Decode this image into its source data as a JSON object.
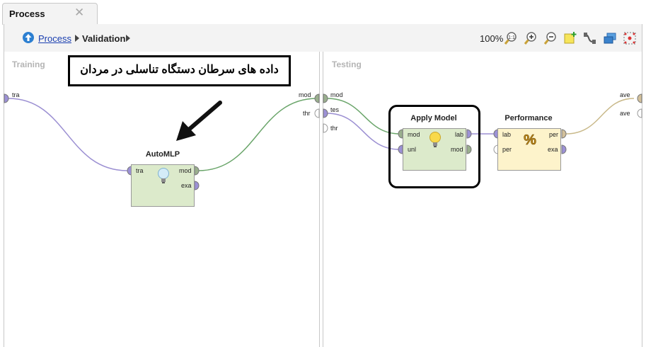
{
  "tab": {
    "label": "Process"
  },
  "breadcrumb": {
    "root": "Process",
    "current": "Validation"
  },
  "toolbar": {
    "zoom": "100%"
  },
  "panels": {
    "left_title": "Training",
    "right_title": "Testing"
  },
  "annotation": {
    "text": "داده های سرطان دستگاه تناسلی در مردان"
  },
  "left_ports": {
    "input": "tra",
    "out_mod": "mod",
    "out_thr": "thr"
  },
  "right_ports": {
    "in_mod": "mod",
    "in_tes": "tes",
    "in_thr": "thr",
    "out_ave1": "ave",
    "out_ave2": "ave"
  },
  "automlp": {
    "title": "AutoMLP",
    "in_tra": "tra",
    "out_mod": "mod",
    "out_exa": "exa"
  },
  "apply_model": {
    "title": "Apply Model",
    "in_mod": "mod",
    "in_unl": "unl",
    "out_lab": "lab",
    "out_mod": "mod"
  },
  "performance": {
    "title": "Performance",
    "in_lab": "lab",
    "in_per": "per",
    "out_per": "per",
    "out_exa": "exa"
  },
  "colors": {
    "operator_green": "#dceacb",
    "operator_yellow": "#fdf3cb",
    "model_port": "#9aaf8e",
    "example_port": "#9c91d6",
    "perf_port": "#d3c09a",
    "wire_model": "#6aa56a",
    "wire_example": "#9b8fd2",
    "wire_perf": "#c9b98a"
  }
}
